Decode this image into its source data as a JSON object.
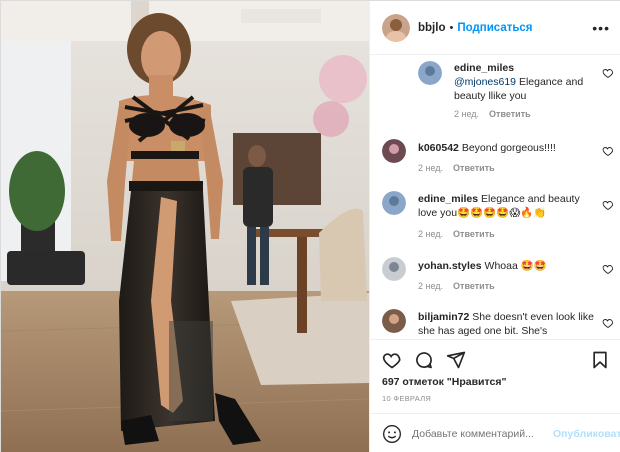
{
  "post": {
    "username": "bbjlo",
    "dot": "•",
    "follow_label": "Подписаться",
    "more_label": "•••"
  },
  "comments": [
    {
      "username": "edine_miles",
      "mention": "@mjones619",
      "text": " Elegance and beauty llike you",
      "time": "2 нед.",
      "reply": "Ответить",
      "avatar_color": "#8aa7c9"
    },
    {
      "username": "k060542",
      "text": "Beyond gorgeous!!!!",
      "time": "2 нед.",
      "reply": "Ответить",
      "avatar_color": "#6b4a52"
    },
    {
      "username": "edine_miles",
      "text": "Elegance and beauty love you🤩🤩🤩🤩😱🔥👏",
      "time": "2 нед.",
      "reply": "Ответить",
      "avatar_color": "#8aa7c9"
    },
    {
      "username": "yohan.styles",
      "text": "Whoaa 🤩🤩",
      "time": "2 нед.",
      "reply": "Ответить",
      "avatar_color": "#c9cdd2"
    },
    {
      "username": "biljamin72",
      "text": "She doesn't even look like she has aged one bit. She's",
      "avatar_color": "#7a5c49"
    }
  ],
  "actions": {
    "likes": "697 отметок \"Нравится\"",
    "date": "10 ФЕВРАЛЯ"
  },
  "add_comment": {
    "placeholder": "Добавьте комментарий...",
    "publish_label": "Опубликовать"
  },
  "icons": {
    "like": "heart-icon",
    "comment": "comment-icon",
    "share": "share-icon",
    "save": "bookmark-icon",
    "emoji": "emoji-icon",
    "more": "more-icon"
  },
  "colors": {
    "link": "#0095f6",
    "publish_disabled": "#b2dffc",
    "mention": "#00376b",
    "muted": "#8e8e8e"
  }
}
